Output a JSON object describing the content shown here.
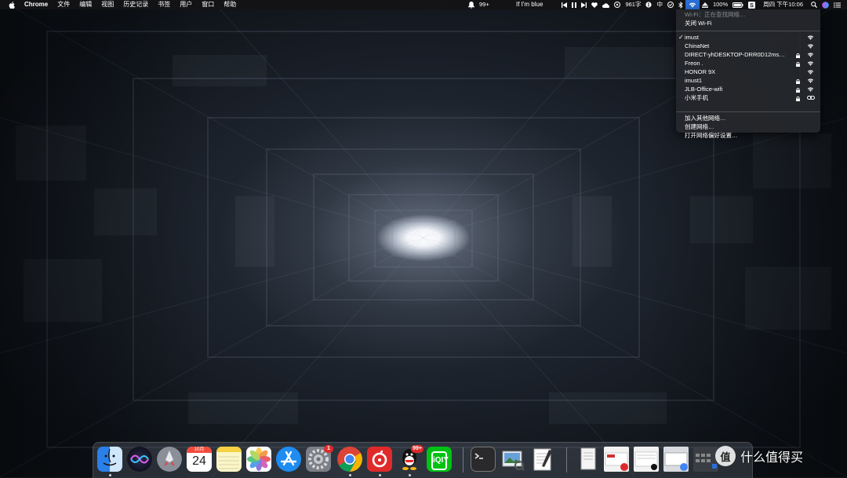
{
  "menubar": {
    "app_name": "Chrome",
    "menus": [
      "文件",
      "编辑",
      "视图",
      "历史记录",
      "书签",
      "用户",
      "窗口",
      "帮助"
    ],
    "notification_badge": "99+",
    "now_playing": "If I'm blue",
    "network_speed": "961字",
    "input_method": "中",
    "battery": "100%",
    "datetime": "周四 下午10:06"
  },
  "wifi_menu": {
    "status_line": "Wi-Fi：正在查找网络…",
    "toggle_label": "关闭 Wi-Fi",
    "networks": [
      {
        "name": "imust",
        "connected": true,
        "locked": false
      },
      {
        "name": "ChinaNet",
        "connected": false,
        "locked": false
      },
      {
        "name": "DIRECT-yhDESKTOP-DRR0D12ms…",
        "connected": false,
        "locked": true
      },
      {
        "name": "Freon .",
        "connected": false,
        "locked": true
      },
      {
        "name": "HONOR 9X",
        "connected": false,
        "locked": false
      },
      {
        "name": "imust1",
        "connected": false,
        "locked": true
      },
      {
        "name": "JLB-Office-wifi",
        "connected": false,
        "locked": true
      },
      {
        "name": "小米手机",
        "connected": false,
        "locked": true
      }
    ],
    "actions": [
      "加入其他网络…",
      "创建网络…",
      "打开网络偏好设置…"
    ]
  },
  "dock": {
    "apps": [
      {
        "name": "finder-icon",
        "running": true
      },
      {
        "name": "siri-icon",
        "running": false
      },
      {
        "name": "launchpad-icon",
        "running": false
      },
      {
        "name": "calendar-icon",
        "running": false
      },
      {
        "name": "notes-icon",
        "running": false
      },
      {
        "name": "photos-icon",
        "running": false
      },
      {
        "name": "app-store-icon",
        "running": false
      },
      {
        "name": "system-preferences-icon",
        "running": false
      },
      {
        "name": "chrome-icon",
        "running": true
      },
      {
        "name": "netease-music-icon",
        "running": true
      },
      {
        "name": "qq-icon",
        "running": true
      },
      {
        "name": "iqiyi-icon",
        "running": false
      }
    ],
    "calendar_month": "10月",
    "calendar_day": "24",
    "system_prefs_badge": "1",
    "qq_badge": "99+",
    "iqiyi_label": "iQIY"
  },
  "watermark": {
    "symbol": "值",
    "text": "什么值得买"
  },
  "colors": {
    "menubar": "#141416",
    "wifi_highlight": "#2a6fd6",
    "badge": "#e02a2a"
  }
}
